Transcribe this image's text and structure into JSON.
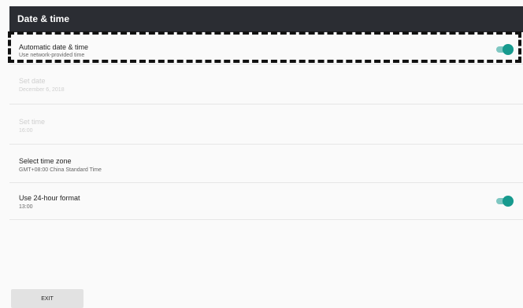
{
  "header": {
    "title": "Date & time"
  },
  "rows": [
    {
      "label": "Automatic date & time",
      "sub": "Use network-provided time",
      "toggle": true
    },
    {
      "label": "Set date",
      "sub": "December 6, 2018"
    },
    {
      "label": "Set time",
      "sub": "16:00"
    },
    {
      "label": "Select time zone",
      "sub": "GMT+08:00 China Standard Time"
    },
    {
      "label": "Use 24-hour format",
      "sub": "13:00",
      "toggle": true
    }
  ],
  "footer": {
    "exit_label": "EXIT"
  },
  "colors": {
    "header_bg": "#2b2d33",
    "toggle_on": "#179a8e"
  }
}
